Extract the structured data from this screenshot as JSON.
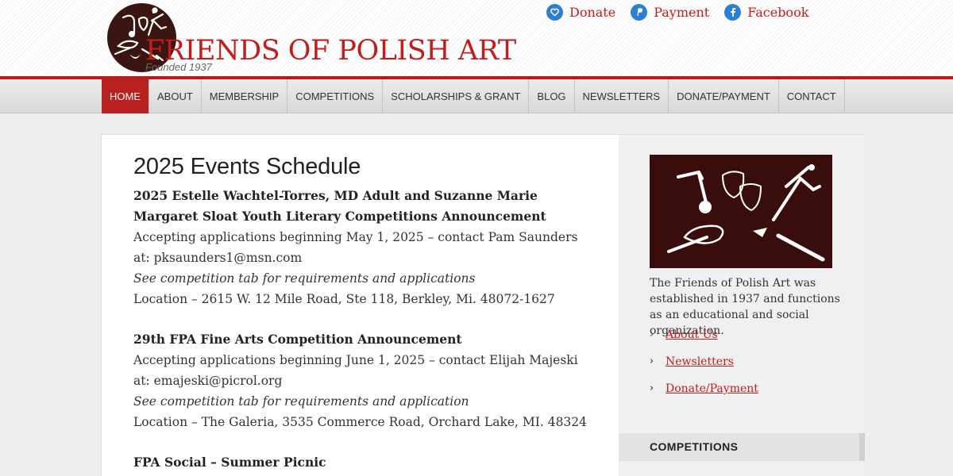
{
  "header": {
    "logo_title": "FRIENDS OF POLISH ART",
    "logo_subtitle": "Founded 1937",
    "top_links": [
      {
        "label": "Donate",
        "icon": "heart-icon"
      },
      {
        "label": "Payment",
        "icon": "paypal-icon"
      },
      {
        "label": "Facebook",
        "icon": "facebook-icon"
      }
    ]
  },
  "nav": {
    "items": [
      "HOME",
      "ABOUT",
      "MEMBERSHIP",
      "COMPETITIONS",
      "SCHOLARSHIPS & GRANT",
      "BLOG",
      "NEWSLETTERS",
      "DONATE/PAYMENT",
      "CONTACT"
    ],
    "active": "HOME"
  },
  "main": {
    "title": "2025 Events Schedule",
    "events": [
      {
        "title": "2025 Estelle Wachtel-Torres, MD Adult and Suzanne Marie Margaret Sloat Youth Literary Competitions Announcement",
        "line1": "Accepting applications beginning May 1, 2025 – contact Pam Saunders at: pksaunders1@msn.com",
        "note": "See competition tab for requirements and applications",
        "location": "Location – 2615 W. 12 Mile Road, Ste 118, Berkley, Mi. 48072-1627"
      },
      {
        "title": "29th FPA Fine Arts Competition Announcement",
        "line1": "Accepting applications beginning June 1, 2025 – contact Elijah Majeski at: emajeski@picrol.org",
        "note": "See competition tab for requirements and application",
        "location": "Location – The Galeria, 3535 Commerce Road, Orchard Lake, MI. 48324"
      },
      {
        "title": "FPA Social – Summer Picnic"
      }
    ]
  },
  "sidebar": {
    "description": "The Friends of Polish Art was established in 1937 and functions as an educational and social organization.",
    "links": [
      "About Us",
      "Newsletters",
      "Donate/Payment"
    ],
    "competitions_heading": "COMPETITIONS"
  },
  "colors": {
    "brand_red": "#c41c1c",
    "nav_active": "#b7211f",
    "icon_blue": "#2e7fd0",
    "logo_dark": "#3a1512"
  }
}
